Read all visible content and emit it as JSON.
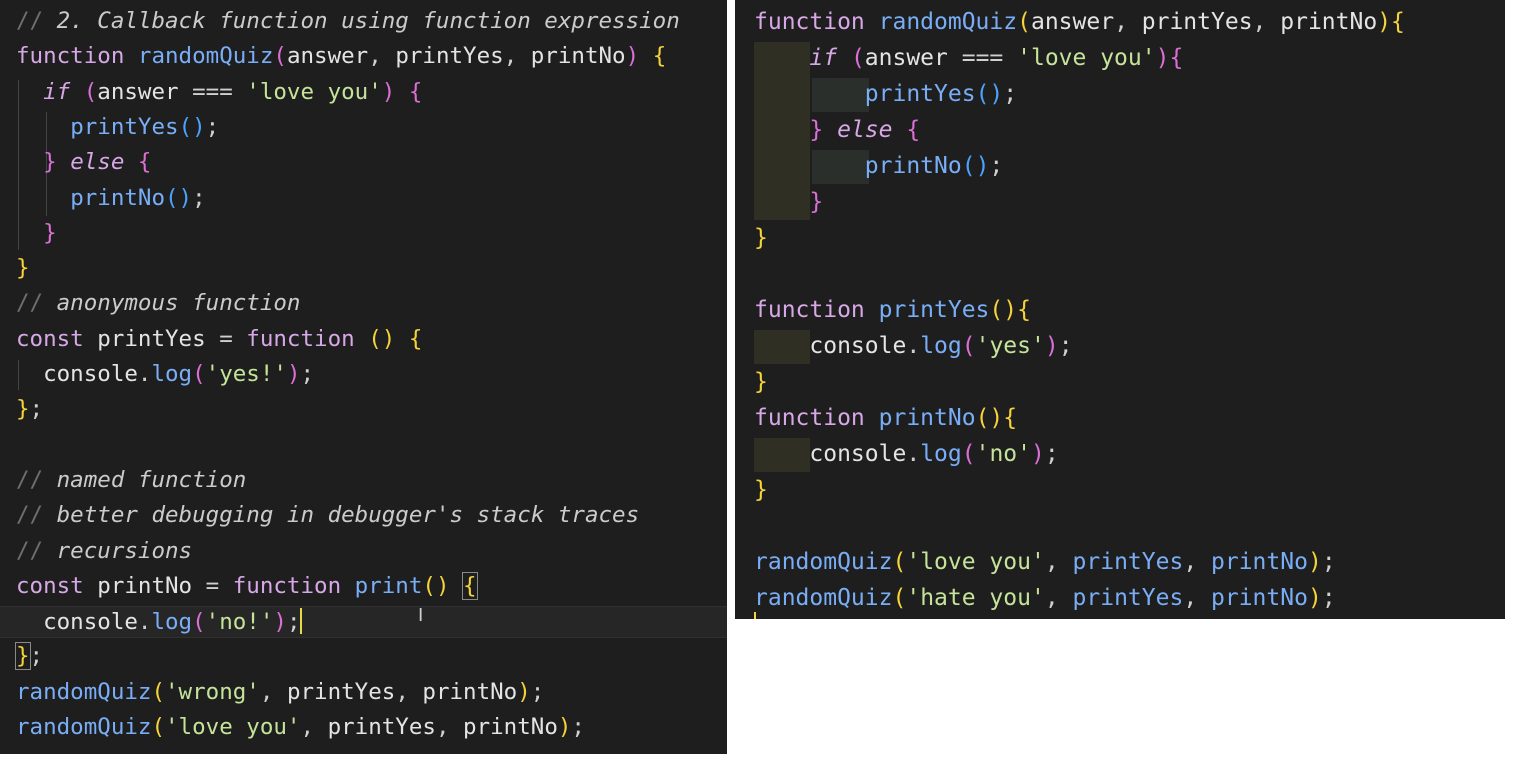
{
  "left_editor": {
    "lines": [
      [
        {
          "t": "// ",
          "c": "cmslash"
        },
        {
          "t": "2. Callback function using function expression",
          "c": "cm"
        }
      ],
      [
        {
          "t": "function ",
          "c": "kw"
        },
        {
          "t": "randomQuiz",
          "c": "fn"
        },
        {
          "t": "(",
          "c": "br2"
        },
        {
          "t": "answer",
          "c": "var"
        },
        {
          "t": ", ",
          "c": "pun"
        },
        {
          "t": "printYes",
          "c": "var"
        },
        {
          "t": ", ",
          "c": "pun"
        },
        {
          "t": "printNo",
          "c": "var"
        },
        {
          "t": ") ",
          "c": "br2"
        },
        {
          "t": "{",
          "c": "br1"
        }
      ],
      [
        {
          "t": "  "
        },
        {
          "t": "if ",
          "c": "kw it"
        },
        {
          "t": "(",
          "c": "br2"
        },
        {
          "t": "answer ",
          "c": "var"
        },
        {
          "t": "=== ",
          "c": "pun"
        },
        {
          "t": "'love you'",
          "c": "str"
        },
        {
          "t": ") ",
          "c": "br2"
        },
        {
          "t": "{",
          "c": "br2"
        }
      ],
      [
        {
          "t": "    "
        },
        {
          "t": "printYes",
          "c": "fn"
        },
        {
          "t": "()",
          "c": "br3"
        },
        {
          "t": ";",
          "c": "pun"
        }
      ],
      [
        {
          "t": "  "
        },
        {
          "t": "} ",
          "c": "br2"
        },
        {
          "t": "else ",
          "c": "kw it"
        },
        {
          "t": "{",
          "c": "br2"
        }
      ],
      [
        {
          "t": "    "
        },
        {
          "t": "printNo",
          "c": "fn"
        },
        {
          "t": "()",
          "c": "br3"
        },
        {
          "t": ";",
          "c": "pun"
        }
      ],
      [
        {
          "t": "  "
        },
        {
          "t": "}",
          "c": "br2"
        }
      ],
      [
        {
          "t": "}",
          "c": "br1"
        }
      ],
      [
        {
          "t": "// ",
          "c": "cmslash"
        },
        {
          "t": "anonymous function",
          "c": "cm"
        }
      ],
      [
        {
          "t": "const ",
          "c": "kw"
        },
        {
          "t": "printYes ",
          "c": "var"
        },
        {
          "t": "= ",
          "c": "pun"
        },
        {
          "t": "function ",
          "c": "kw"
        },
        {
          "t": "() ",
          "c": "br1"
        },
        {
          "t": "{",
          "c": "br1"
        }
      ],
      [
        {
          "t": "  "
        },
        {
          "t": "console",
          "c": "var"
        },
        {
          "t": ".",
          "c": "pun"
        },
        {
          "t": "log",
          "c": "fn"
        },
        {
          "t": "(",
          "c": "br2"
        },
        {
          "t": "'yes!'",
          "c": "str"
        },
        {
          "t": ")",
          "c": "br2"
        },
        {
          "t": ";",
          "c": "pun"
        }
      ],
      [
        {
          "t": "}",
          "c": "br1"
        },
        {
          "t": ";",
          "c": "pun"
        }
      ],
      [],
      [
        {
          "t": "// ",
          "c": "cmslash"
        },
        {
          "t": "named function",
          "c": "cm"
        }
      ],
      [
        {
          "t": "// ",
          "c": "cmslash"
        },
        {
          "t": "better debugging in debugger's stack traces",
          "c": "cm"
        }
      ],
      [
        {
          "t": "// ",
          "c": "cmslash"
        },
        {
          "t": "recursions",
          "c": "cm"
        }
      ],
      [
        {
          "t": "const ",
          "c": "kw"
        },
        {
          "t": "printNo ",
          "c": "var"
        },
        {
          "t": "= ",
          "c": "pun"
        },
        {
          "t": "function ",
          "c": "kw"
        },
        {
          "t": "print",
          "c": "fn"
        },
        {
          "t": "() ",
          "c": "br1"
        },
        {
          "t": "{",
          "c": "br1 bracket-box"
        }
      ],
      [
        {
          "t": "  "
        },
        {
          "t": "console",
          "c": "var"
        },
        {
          "t": ".",
          "c": "pun"
        },
        {
          "t": "log",
          "c": "fn"
        },
        {
          "t": "(",
          "c": "br2"
        },
        {
          "t": "'no!'",
          "c": "str"
        },
        {
          "t": ")",
          "c": "br2"
        },
        {
          "t": ";",
          "c": "pun"
        },
        {
          "caret": true
        }
      ],
      [
        {
          "t": "}",
          "c": "br1 bracket-box"
        },
        {
          "t": ";",
          "c": "pun"
        }
      ],
      [
        {
          "t": "randomQuiz",
          "c": "fn"
        },
        {
          "t": "(",
          "c": "br1"
        },
        {
          "t": "'wrong'",
          "c": "str"
        },
        {
          "t": ", ",
          "c": "pun"
        },
        {
          "t": "printYes",
          "c": "var"
        },
        {
          "t": ", ",
          "c": "pun"
        },
        {
          "t": "printNo",
          "c": "var"
        },
        {
          "t": ")",
          "c": "br1"
        },
        {
          "t": ";",
          "c": "pun"
        }
      ],
      [
        {
          "t": "randomQuiz",
          "c": "fn"
        },
        {
          "t": "(",
          "c": "br1"
        },
        {
          "t": "'love you'",
          "c": "str"
        },
        {
          "t": ", ",
          "c": "pun"
        },
        {
          "t": "printYes",
          "c": "var"
        },
        {
          "t": ", ",
          "c": "pun"
        },
        {
          "t": "printNo",
          "c": "var"
        },
        {
          "t": ")",
          "c": "br1"
        },
        {
          "t": ";",
          "c": "pun"
        }
      ]
    ]
  },
  "right_editor": {
    "lines": [
      [
        {
          "t": "function ",
          "c": "kw"
        },
        {
          "t": "randomQuiz",
          "c": "fn"
        },
        {
          "t": "(",
          "c": "br1"
        },
        {
          "t": "answer",
          "c": "var"
        },
        {
          "t": ", ",
          "c": "pun"
        },
        {
          "t": "printYes",
          "c": "var"
        },
        {
          "t": ", ",
          "c": "pun"
        },
        {
          "t": "printNo",
          "c": "var"
        },
        {
          "t": ")",
          "c": "br1"
        },
        {
          "t": "{",
          "c": "br1"
        }
      ],
      [
        {
          "t": "    "
        },
        {
          "t": "if ",
          "c": "kw it"
        },
        {
          "t": "(",
          "c": "br2"
        },
        {
          "t": "answer ",
          "c": "var"
        },
        {
          "t": "=== ",
          "c": "pun"
        },
        {
          "t": "'love you'",
          "c": "str"
        },
        {
          "t": ")",
          "c": "br2"
        },
        {
          "t": "{",
          "c": "br2"
        }
      ],
      [
        {
          "t": "        "
        },
        {
          "t": "printYes",
          "c": "fn"
        },
        {
          "t": "()",
          "c": "br3"
        },
        {
          "t": ";",
          "c": "pun"
        }
      ],
      [
        {
          "t": "    "
        },
        {
          "t": "} ",
          "c": "br2"
        },
        {
          "t": "else ",
          "c": "kw it"
        },
        {
          "t": "{",
          "c": "br2"
        }
      ],
      [
        {
          "t": "        "
        },
        {
          "t": "printNo",
          "c": "fn"
        },
        {
          "t": "()",
          "c": "br3"
        },
        {
          "t": ";",
          "c": "pun"
        }
      ],
      [
        {
          "t": "    "
        },
        {
          "t": "}",
          "c": "br2"
        }
      ],
      [
        {
          "t": "}",
          "c": "br1"
        }
      ],
      [],
      [
        {
          "t": "function ",
          "c": "kw"
        },
        {
          "t": "printYes",
          "c": "fn"
        },
        {
          "t": "()",
          "c": "br1"
        },
        {
          "t": "{",
          "c": "br1"
        }
      ],
      [
        {
          "t": "    "
        },
        {
          "t": "console",
          "c": "var"
        },
        {
          "t": ".",
          "c": "pun"
        },
        {
          "t": "log",
          "c": "fn"
        },
        {
          "t": "(",
          "c": "br2"
        },
        {
          "t": "'yes'",
          "c": "str"
        },
        {
          "t": ")",
          "c": "br2"
        },
        {
          "t": ";",
          "c": "pun"
        }
      ],
      [
        {
          "t": "}",
          "c": "br1"
        }
      ],
      [
        {
          "t": "function ",
          "c": "kw"
        },
        {
          "t": "printNo",
          "c": "fn"
        },
        {
          "t": "()",
          "c": "br1"
        },
        {
          "t": "{",
          "c": "br1"
        }
      ],
      [
        {
          "t": "    "
        },
        {
          "t": "console",
          "c": "var"
        },
        {
          "t": ".",
          "c": "pun"
        },
        {
          "t": "log",
          "c": "fn"
        },
        {
          "t": "(",
          "c": "br2"
        },
        {
          "t": "'no'",
          "c": "str"
        },
        {
          "t": ")",
          "c": "br2"
        },
        {
          "t": ";",
          "c": "pun"
        }
      ],
      [
        {
          "t": "}",
          "c": "br1"
        }
      ],
      [],
      [
        {
          "t": "randomQuiz",
          "c": "fn"
        },
        {
          "t": "(",
          "c": "br1"
        },
        {
          "t": "'love you'",
          "c": "str"
        },
        {
          "t": ", ",
          "c": "pun"
        },
        {
          "t": "printYes",
          "c": "fn"
        },
        {
          "t": ", ",
          "c": "pun"
        },
        {
          "t": "printNo",
          "c": "fn"
        },
        {
          "t": ")",
          "c": "br1"
        },
        {
          "t": ";",
          "c": "pun"
        }
      ],
      [
        {
          "t": "randomQuiz",
          "c": "fn"
        },
        {
          "t": "(",
          "c": "br1"
        },
        {
          "t": "'hate you'",
          "c": "str"
        },
        {
          "t": ", ",
          "c": "pun"
        },
        {
          "t": "printYes",
          "c": "fn"
        },
        {
          "t": ", ",
          "c": "pun"
        },
        {
          "t": "printNo",
          "c": "fn"
        },
        {
          "t": ")",
          "c": "br1"
        },
        {
          "t": ";",
          "c": "pun"
        }
      ]
    ]
  }
}
